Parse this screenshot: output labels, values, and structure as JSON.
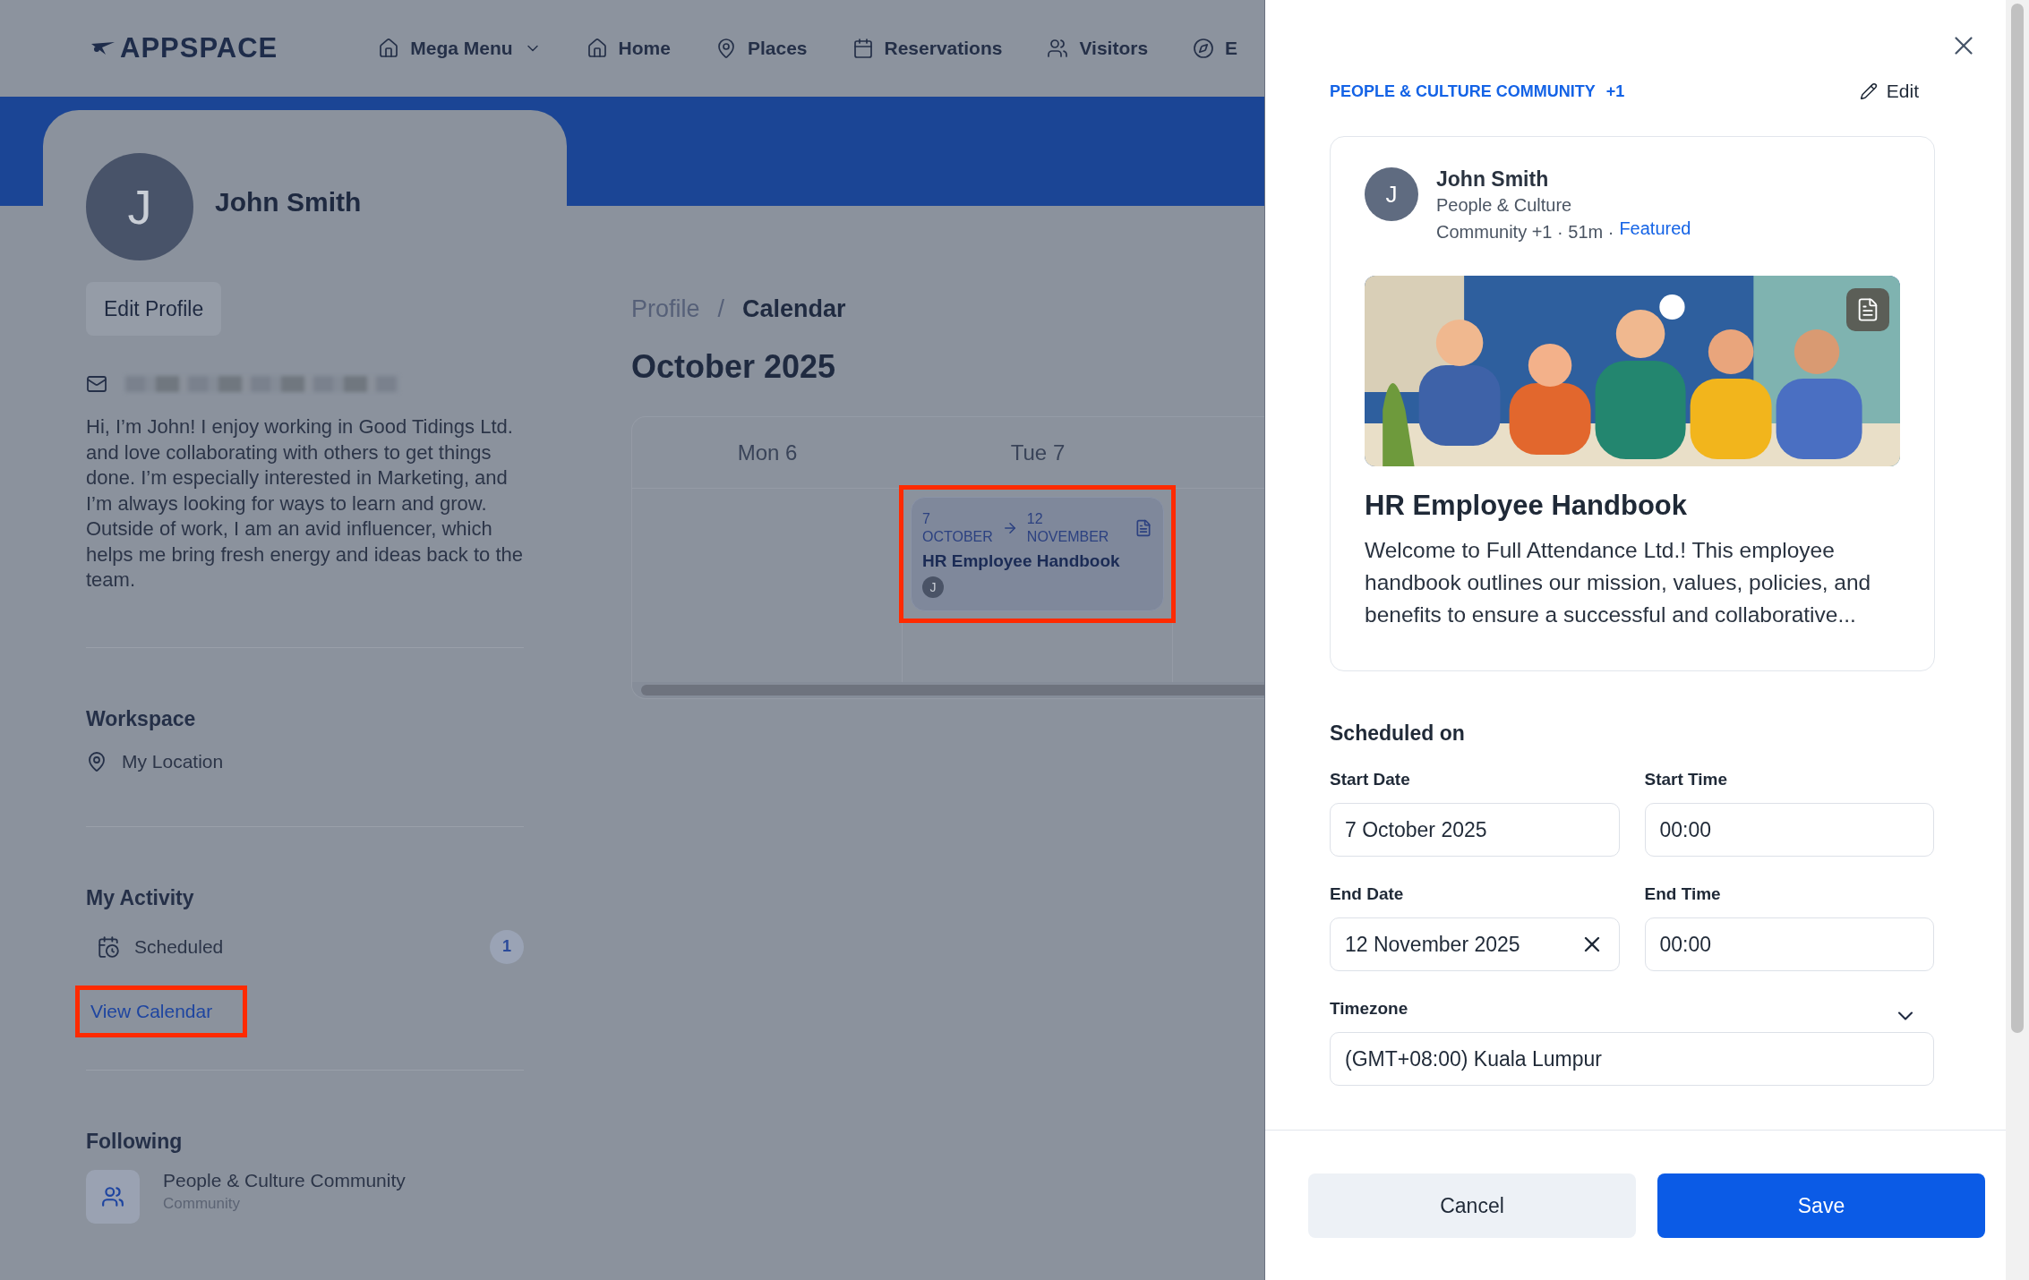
{
  "nav": {
    "logo": "APPSPACE",
    "items": [
      {
        "label": "Mega Menu",
        "dropdown": true
      },
      {
        "label": "Home",
        "dropdown": false
      },
      {
        "label": "Places",
        "dropdown": false
      },
      {
        "label": "Reservations",
        "dropdown": false
      },
      {
        "label": "Visitors",
        "dropdown": false
      },
      {
        "label": "E",
        "dropdown": false
      }
    ]
  },
  "profile": {
    "name": "John Smith",
    "avatar_initial": "J",
    "edit_button": "Edit Profile",
    "bio": "Hi, I’m John! I enjoy working in Good Tidings Ltd. and love collaborating with others to get things done. I’m especially interested in Marketing, and I’m always looking for ways to learn and grow. Outside of work, I am an avid influencer, which helps me bring fresh energy and ideas back to the team.",
    "workspace": {
      "heading": "Workspace",
      "location": "My Location"
    },
    "activity": {
      "heading": "My Activity",
      "items": [
        {
          "label": "Scheduled",
          "count": "1"
        }
      ],
      "link": "View Calendar"
    },
    "following": {
      "heading": "Following",
      "items": [
        {
          "name": "People & Culture Community",
          "type": "Community"
        }
      ]
    }
  },
  "main": {
    "breadcrumb_separator": "/",
    "breadcrumb": [
      {
        "label": "Profile",
        "current": false
      },
      {
        "label": "Calendar",
        "current": true
      }
    ],
    "month": "October 2025",
    "days": [
      {
        "label": "Mon 6"
      },
      {
        "label": "Tue 7",
        "events": [
          {
            "start_day": "7",
            "start_month": "OCTOBER",
            "end_day": "12",
            "end_month": "NOVEMBER",
            "title": "HR Employee Handbook",
            "author_initial": "J"
          }
        ]
      }
    ]
  },
  "drawer": {
    "community": "PEOPLE & CULTURE COMMUNITY",
    "community_extra": "+1",
    "edit": "Edit",
    "post": {
      "author": "John Smith",
      "avatar_initial": "J",
      "meta_line": "People & Culture",
      "meta_rest": "Community +1 · 51m ·",
      "featured": "Featured",
      "title": "HR Employee Handbook",
      "description": "Welcome to Full Attendance Ltd.! This employee handbook outlines our mission, values, policies, and benefits to ensure a successful and collaborative..."
    },
    "schedule": {
      "heading": "Scheduled on",
      "fields": [
        {
          "label": "Start Date",
          "value": "7 October 2025",
          "kind": "date",
          "clearable": false
        },
        {
          "label": "Start Time",
          "value": "00:00",
          "kind": "time",
          "clearable": false
        },
        {
          "label": "End Date",
          "value": "12 November 2025",
          "kind": "date",
          "clearable": true
        },
        {
          "label": "End Time",
          "value": "00:00",
          "kind": "time",
          "clearable": false
        },
        {
          "label": "Timezone",
          "value": "(GMT+08:00) Kuala Lumpur",
          "kind": "select",
          "clearable": false
        }
      ]
    },
    "buttons": [
      {
        "label": "Cancel",
        "kind": "secondary"
      },
      {
        "label": "Save",
        "kind": "primary"
      }
    ]
  }
}
